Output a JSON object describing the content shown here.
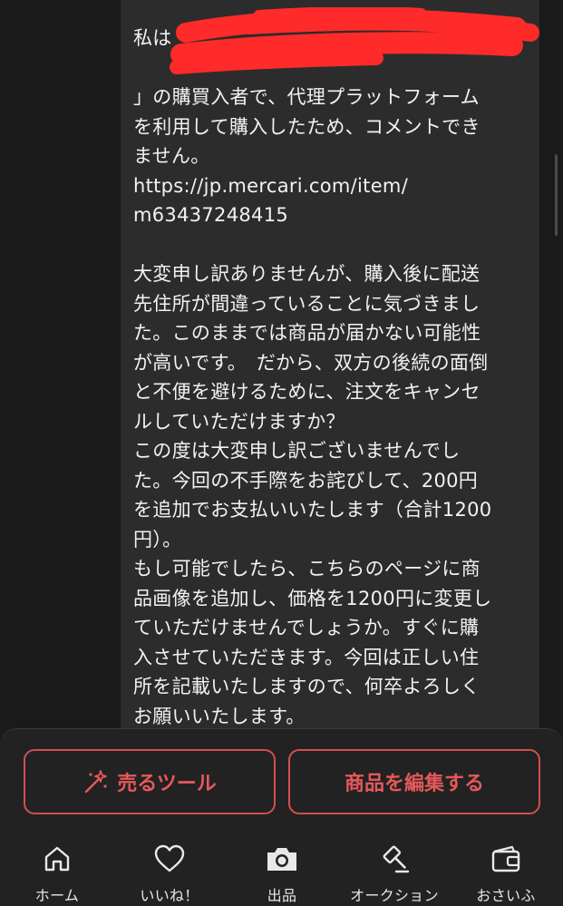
{
  "message": {
    "lines": [
      "私は「",
      "",
      "」の購買入者で、代理プラットフォーム",
      "を利用して購入したため、コメントでき",
      "ません。",
      "https://jp.mercari.com/item/",
      "m63437248415",
      "",
      "大変申し訳ありませんが、購入後に配送",
      "先住所が間違っていることに気づきまし",
      "た。このままでは商品が届かない可能性",
      "が高いです。　だから、双方の後続の面倒",
      "と不便を避けるために、注文をキャンセ",
      "ルしていただけますか？",
      "この度は大変申し訳ございませんでし",
      "た。今回の不手際をお詫びして、200円",
      "を追加でお支払いいたします（合計1200",
      "円）。",
      "もし可能でしたら、こちらのページに商",
      "品画像を追加し、価格を1200円に変更し",
      "ていただけませんでしょうか。すぐに購",
      "入させていただきます。今回は正しい住",
      "所を記載いたしますので、何卒よろしく",
      "お願いいたします。"
    ]
  },
  "actions": {
    "sell_tool_label": "売るツール",
    "edit_item_label": "商品を編集する"
  },
  "nav": {
    "items": [
      {
        "label": "ホーム",
        "icon": "home-icon"
      },
      {
        "label": "いいね！",
        "icon": "heart-icon"
      },
      {
        "label": "出品",
        "icon": "camera-icon"
      },
      {
        "label": "オークション",
        "icon": "gavel-icon"
      },
      {
        "label": "おさいふ",
        "icon": "wallet-icon"
      }
    ]
  },
  "colors": {
    "background": "#1a1a1a",
    "bubble": "#2c2c2c",
    "accent": "#e6585a",
    "redaction": "#ff2a2a"
  }
}
